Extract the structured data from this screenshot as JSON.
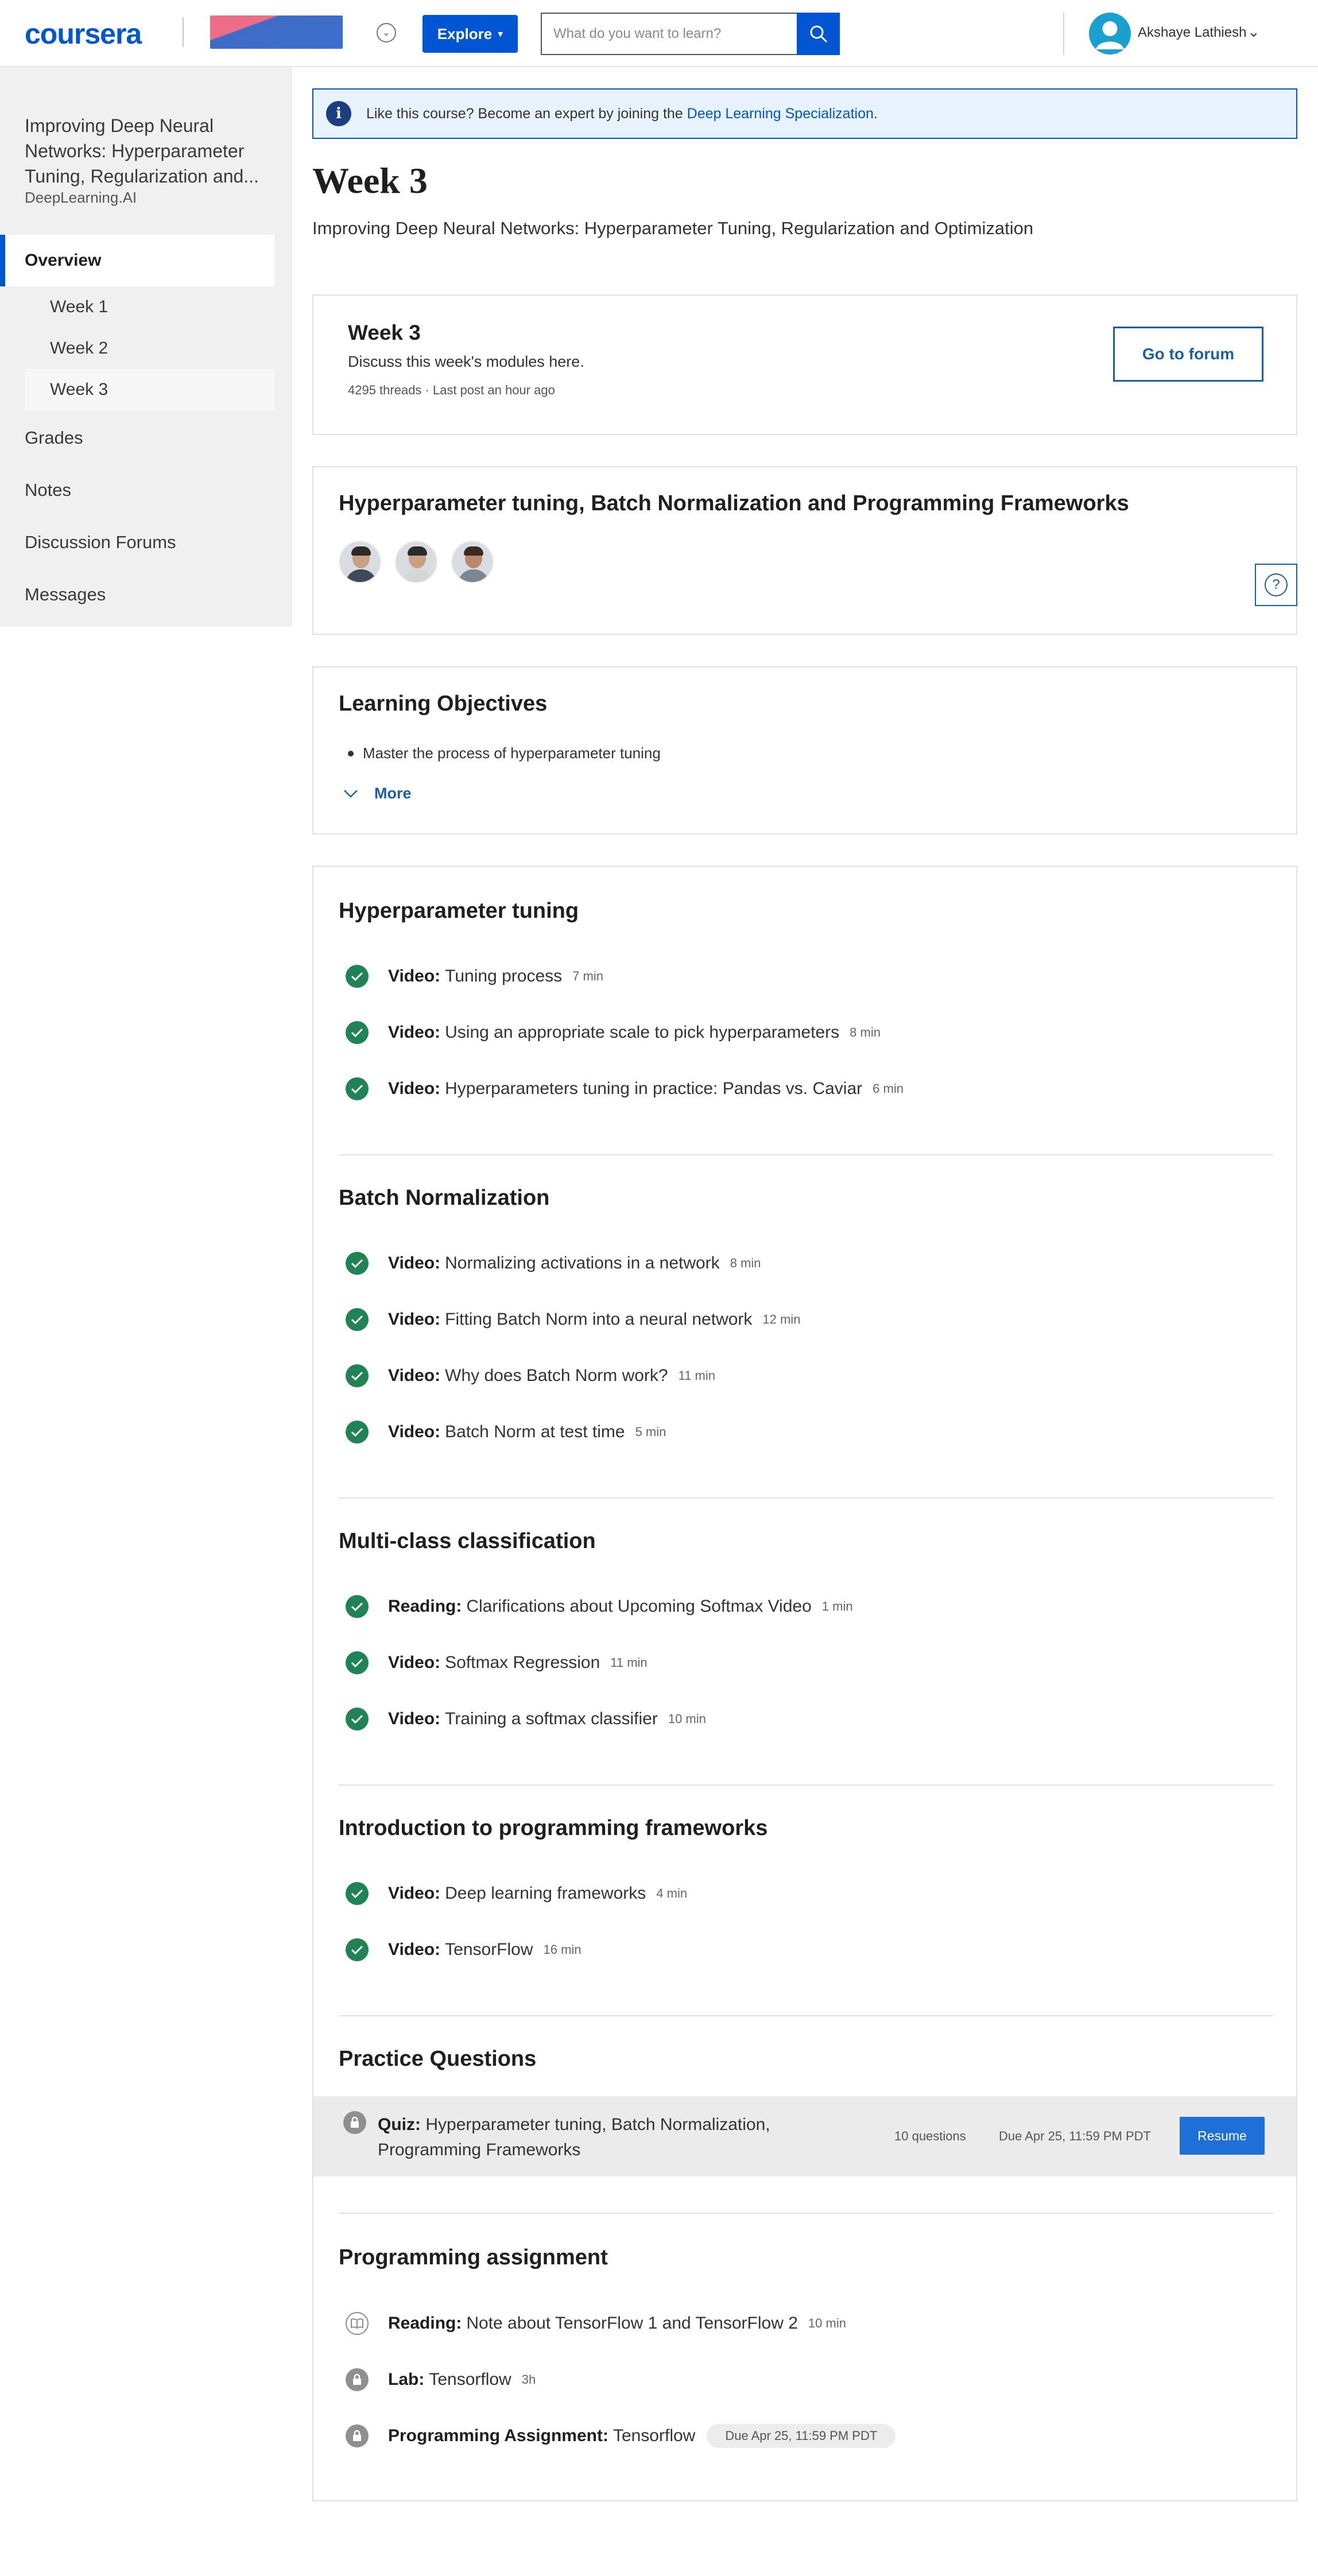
{
  "header": {
    "logo": "coursera",
    "explore_label": "Explore",
    "search_placeholder": "What do you want to learn?",
    "user_name": "Akshaye Lathiesh",
    "brand_color": "#0056d2"
  },
  "sidebar": {
    "course_title": "Improving Deep Neural Networks: Hyperparameter Tuning, Regularization and...",
    "org": "DeepLearning.AI",
    "overview_label": "Overview",
    "weeks": [
      "Week 1",
      "Week 2",
      "Week 3"
    ],
    "items": [
      "Grades",
      "Notes",
      "Discussion Forums",
      "Messages"
    ]
  },
  "banner": {
    "text": "Like this course? Become an expert by joining the ",
    "link": "Deep Learning Specialization",
    "suffix": "."
  },
  "page": {
    "title": "Week 3",
    "subtitle": "Improving Deep Neural Networks: Hyperparameter Tuning, Regularization and Optimization"
  },
  "forum": {
    "title": "Week 3",
    "description": "Discuss this week's modules here.",
    "meta": "4295 threads · Last post an hour ago",
    "button": "Go to forum"
  },
  "module": {
    "title": "Hyperparameter tuning, Batch Normalization and Programming Frameworks"
  },
  "objectives": {
    "title": "Learning Objectives",
    "items": [
      "Master the process of hyperparameter tuning"
    ],
    "more_label": "More"
  },
  "sections": [
    {
      "title": "Hyperparameter tuning",
      "items": [
        {
          "type": "Video:",
          "name": "Tuning process",
          "duration": "7 min"
        },
        {
          "type": "Video:",
          "name": "Using an appropriate scale to pick hyperparameters",
          "duration": "8 min"
        },
        {
          "type": "Video:",
          "name": "Hyperparameters tuning in practice: Pandas vs. Caviar",
          "duration": "6 min"
        }
      ]
    },
    {
      "title": "Batch Normalization",
      "items": [
        {
          "type": "Video:",
          "name": "Normalizing activations in a network",
          "duration": "8 min"
        },
        {
          "type": "Video:",
          "name": "Fitting Batch Norm into a neural network",
          "duration": "12 min"
        },
        {
          "type": "Video:",
          "name": "Why does Batch Norm work?",
          "duration": "11 min"
        },
        {
          "type": "Video:",
          "name": "Batch Norm at test time",
          "duration": "5 min"
        }
      ]
    },
    {
      "title": "Multi-class classification",
      "items": [
        {
          "type": "Reading:",
          "name": "Clarifications about Upcoming Softmax Video",
          "duration": "1 min"
        },
        {
          "type": "Video:",
          "name": "Softmax Regression",
          "duration": "11 min"
        },
        {
          "type": "Video:",
          "name": "Training a softmax classifier",
          "duration": "10 min"
        }
      ]
    },
    {
      "title": "Introduction to programming frameworks",
      "items": [
        {
          "type": "Video:",
          "name": "Deep learning frameworks",
          "duration": "4 min"
        },
        {
          "type": "Video:",
          "name": "TensorFlow",
          "duration": "16 min"
        }
      ]
    }
  ],
  "practice": {
    "title": "Practice Questions",
    "quiz_type": "Quiz:",
    "quiz_name": "Hyperparameter tuning, Batch Normalization, Programming Frameworks",
    "questions": "10 questions",
    "due": "Due Apr 25, 11:59 PM PDT",
    "button": "Resume"
  },
  "assignment": {
    "title": "Programming assignment",
    "items": [
      {
        "type": "Reading:",
        "name": "Note about TensorFlow 1 and TensorFlow 2",
        "duration": "10 min"
      },
      {
        "type": "Lab:",
        "name": "Tensorflow",
        "duration": "3h"
      },
      {
        "type": "Programming Assignment:",
        "name": "Tensorflow",
        "due": "Due Apr 25, 11:59 PM PDT"
      }
    ]
  }
}
